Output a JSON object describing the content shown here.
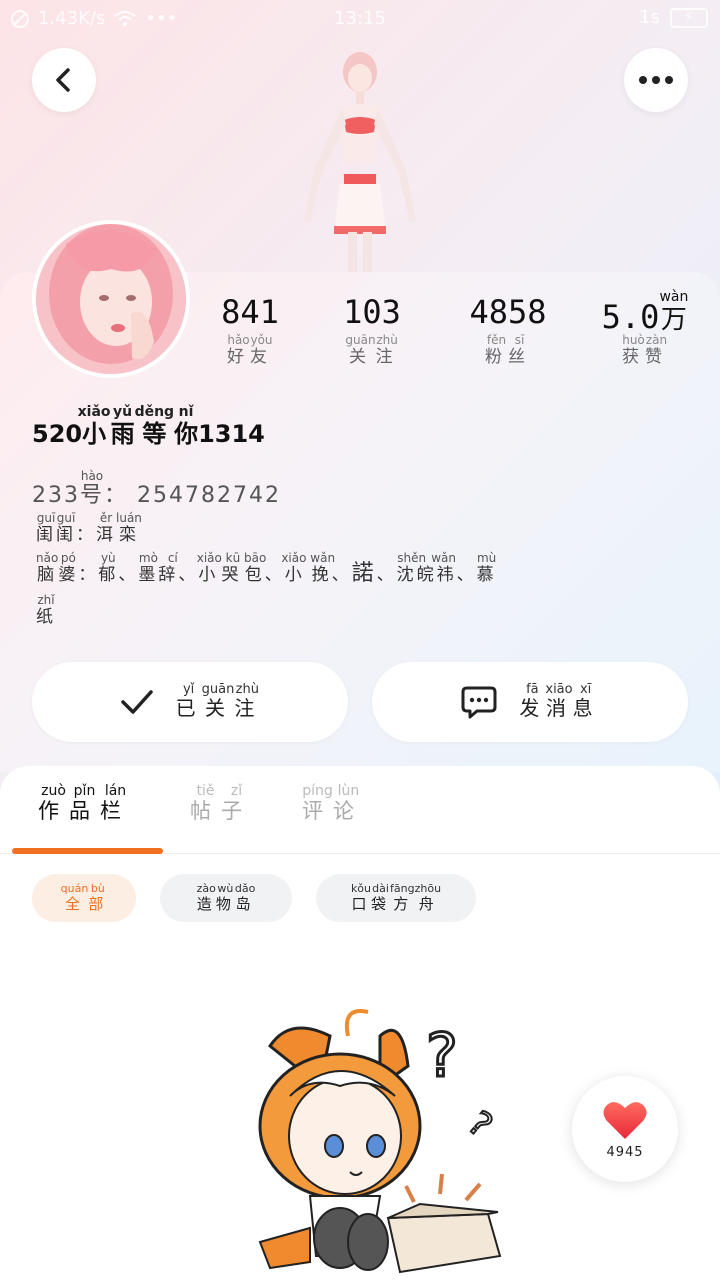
{
  "status_bar": {
    "network_speed": "1.43K/s",
    "dots": "•••",
    "time": "13:15",
    "signal": "1s",
    "battery_icon": "battery-charging-icon"
  },
  "header": {
    "back_icon": "chevron-left-icon",
    "more_icon": "more-dots-icon"
  },
  "stats": [
    {
      "value": "841",
      "label": "好友",
      "pinyin": [
        "hǎo",
        "yǒu"
      ]
    },
    {
      "value": "103",
      "label": "关注",
      "pinyin": [
        "guān",
        "zhù"
      ]
    },
    {
      "value": "4858",
      "label": "粉丝",
      "pinyin": [
        "fěn",
        "sī"
      ]
    },
    {
      "value": "5.0",
      "unit": "万",
      "unit_pinyin": "wàn",
      "label": "获赞",
      "pinyin": [
        "huò",
        "zàn"
      ]
    }
  ],
  "profile": {
    "nickname_prefix": "520",
    "nickname_chars": [
      "小",
      "雨",
      "等",
      "你"
    ],
    "nickname_pinyin": [
      "xiǎo",
      "yǔ",
      "děng",
      "nǐ"
    ],
    "nickname_suffix": "1314",
    "uid_prefix": "233",
    "uid_char": "号",
    "uid_char_pinyin": "hào",
    "uid_colon": "：",
    "uid_value": "254782742",
    "bio_line1": {
      "chars": [
        "闺",
        "闺",
        "洱",
        "栾"
      ],
      "pinyin": [
        "guī",
        "guī",
        "ěr",
        "luán"
      ],
      "colon": "："
    },
    "bio_line2": {
      "prefix_chars": [
        "脑",
        "婆",
        "郁"
      ],
      "prefix_pinyin": [
        "nǎo",
        "pó",
        "yù"
      ],
      "colon": "：",
      "items": [
        "墨辞",
        "小哭包",
        "小挽",
        "諾",
        "沈皖祎",
        "慕纸"
      ],
      "items_pinyin": [
        [
          "mò",
          "cí"
        ],
        [
          "xiǎo",
          "kū",
          "bāo"
        ],
        [
          "xiǎo",
          "wǎn"
        ],
        [
          ""
        ],
        [
          "shěn",
          "wǎn",
          ""
        ],
        [
          "mù",
          "zhǐ"
        ]
      ],
      "separator": "、"
    }
  },
  "actions": {
    "follow_label": "已关注",
    "follow_pinyin": [
      "yǐ",
      "guān",
      "zhù"
    ],
    "follow_icon": "check-icon",
    "message_label": "发消息",
    "message_pinyin": [
      "fā",
      "xiāo",
      "xī"
    ],
    "message_icon": "chat-bubble-icon"
  },
  "tabs": [
    {
      "label": "作品栏",
      "pinyin": [
        "zuò",
        "pǐn",
        "lán"
      ],
      "active": true
    },
    {
      "label": "帖子",
      "pinyin": [
        "tiě",
        "zǐ"
      ],
      "active": false
    },
    {
      "label": "评论",
      "pinyin": [
        "píng",
        "lùn"
      ],
      "active": false
    }
  ],
  "filters": [
    {
      "label": "全部",
      "pinyin": [
        "quán",
        "bù"
      ],
      "active": true
    },
    {
      "label": "造物岛",
      "pinyin": [
        "zào",
        "wù",
        "dǎo"
      ],
      "active": false
    },
    {
      "label": "口袋方舟",
      "pinyin": [
        "kǒu",
        "dài",
        "fāngzhōu"
      ],
      "active": false
    }
  ],
  "like_fab": {
    "icon": "heart-icon",
    "count": "4945"
  },
  "colors": {
    "accent": "#f07022",
    "heart": "#f0443f"
  }
}
